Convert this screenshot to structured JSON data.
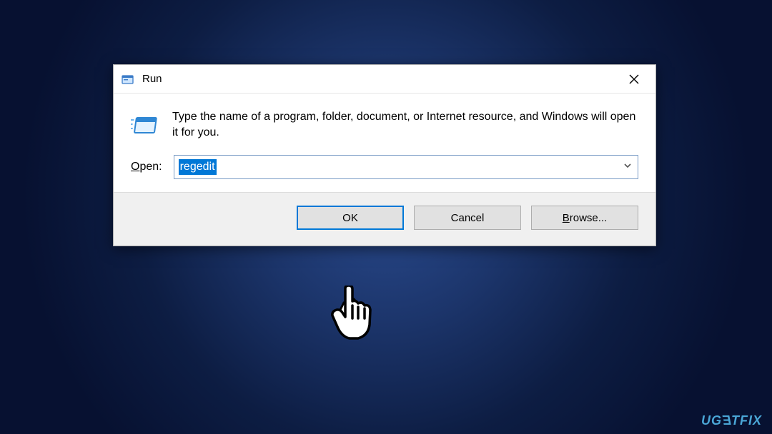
{
  "dialog": {
    "title": "Run",
    "description": "Type the name of a program, folder, document, or Internet resource, and Windows will open it for you.",
    "open_label_pre": "O",
    "open_label_post": "pen:",
    "input_value": "regedit",
    "buttons": {
      "ok": "OK",
      "cancel": "Cancel",
      "browse_pre": "B",
      "browse_post": "rowse..."
    }
  },
  "watermark": "UGƎTFIX"
}
